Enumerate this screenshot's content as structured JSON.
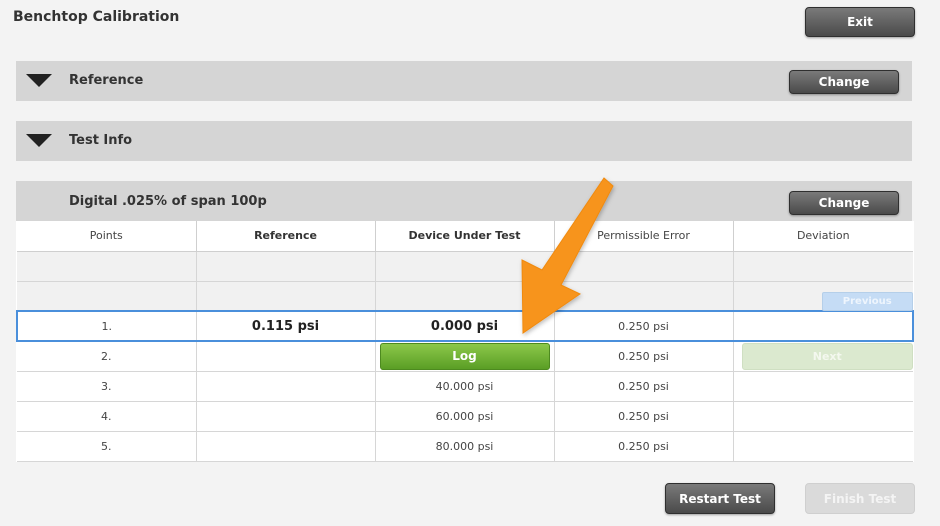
{
  "app": {
    "title": "Benchtop Calibration",
    "exit_label": "Exit"
  },
  "sections": {
    "reference": {
      "label": "Reference",
      "change_label": "Change"
    },
    "test_info": {
      "label": "Test Info"
    },
    "procedure": {
      "label": "Digital .025% of span 100p",
      "change_label": "Change"
    }
  },
  "table": {
    "headers": [
      "Points",
      "Reference",
      "Device Under Test",
      "Permissible Error",
      "Deviation"
    ],
    "rows": [
      {
        "point": "1.",
        "reference": "0.115 psi",
        "dut": "0.000 psi",
        "perm_error": "0.250 psi",
        "deviation": ""
      },
      {
        "point": "2.",
        "reference": "",
        "dut": "",
        "perm_error": "0.250 psi",
        "deviation": ""
      },
      {
        "point": "3.",
        "reference": "",
        "dut": "40.000 psi",
        "perm_error": "0.250 psi",
        "deviation": ""
      },
      {
        "point": "4.",
        "reference": "",
        "dut": "60.000 psi",
        "perm_error": "0.250 psi",
        "deviation": ""
      },
      {
        "point": "5.",
        "reference": "",
        "dut": "80.000 psi",
        "perm_error": "0.250 psi",
        "deviation": ""
      }
    ],
    "log_label": "Log",
    "previous_label": "Previous",
    "next_label": "Next"
  },
  "footer": {
    "restart_label": "Restart Test",
    "finish_label": "Finish Test"
  },
  "colors": {
    "accent_arrow": "#f7941d",
    "log_green": "#6aab30",
    "selection_blue": "#4a8fdb"
  },
  "icons": {
    "section_toggle": "triangle-down-icon",
    "callout": "arrow-annotation"
  }
}
